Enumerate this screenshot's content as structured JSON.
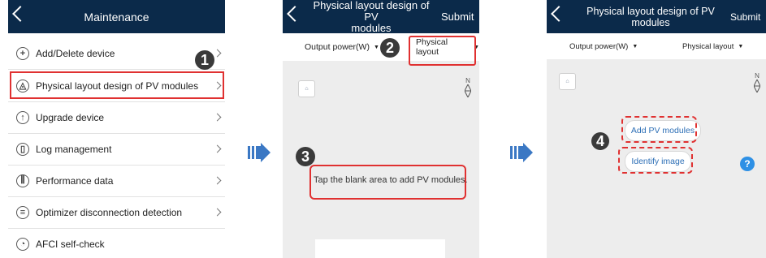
{
  "colors": {
    "header": "#0b2a4a",
    "highlight": "#e03131",
    "link": "#2d6fb6",
    "help": "#2e90e5",
    "badge": "#3a3a3a"
  },
  "panel1": {
    "title": "Maintenance",
    "items": [
      {
        "label": "Add/Delete device",
        "icon": "plus-circle-icon",
        "glyph": "+"
      },
      {
        "label": "Physical layout design of PV modules",
        "icon": "layout-circle-icon",
        "glyph": "◬"
      },
      {
        "label": "Upgrade device",
        "icon": "upload-circle-icon",
        "glyph": "↑"
      },
      {
        "label": "Log management",
        "icon": "document-circle-icon",
        "glyph": "▯"
      },
      {
        "label": "Performance data",
        "icon": "sliders-circle-icon",
        "glyph": "⫼"
      },
      {
        "label": "Optimizer disconnection detection",
        "icon": "optimizer-circle-icon",
        "glyph": "≡"
      },
      {
        "label": "AFCI self-check",
        "icon": "arc-circle-icon",
        "glyph": "◔"
      }
    ],
    "step": "1"
  },
  "panel2": {
    "title_line1": "Physical layout design of PV",
    "title_line2": "modules",
    "submit": "Submit",
    "left_selector": "Output power(W)",
    "right_selector": "Physical layout",
    "compass": "N",
    "hint": "Tap the blank area to add PV modules.",
    "step_a": "2",
    "step_b": "3"
  },
  "panel3": {
    "title_line1": "Physical layout design of PV",
    "title_line2": "modules",
    "submit": "Submit",
    "left_selector": "Output power(W)",
    "right_selector": "Physical layout",
    "compass": "N",
    "add_modules": "Add PV modules",
    "identify_image": "Identify image",
    "help": "?",
    "step": "4"
  }
}
